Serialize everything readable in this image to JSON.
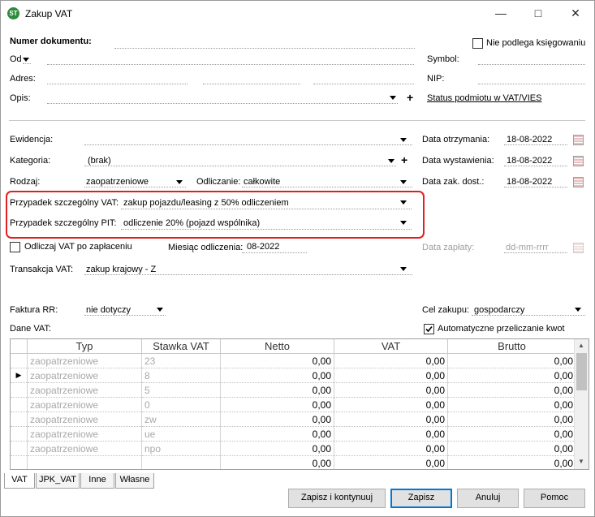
{
  "window": {
    "title": "Zakup VAT",
    "app_icon": "ST"
  },
  "header": {
    "document_number_label": "Numer dokumentu:",
    "not_booked_label": "Nie podlega księgowaniu",
    "from_label": "Od",
    "symbol_label": "Symbol:",
    "address_label": "Adres:",
    "nip_label": "NIP:",
    "description_label": "Opis:",
    "plus": "+",
    "vat_status_link": "Status podmiotu w VAT/VIES"
  },
  "details": {
    "ewidencja_label": "Ewidencja:",
    "kategoria_label": "Kategoria:",
    "kategoria_value": "(brak)",
    "rodzaj_label": "Rodzaj:",
    "rodzaj_value": "zaopatrzeniowe",
    "odliczanie_label": "Odliczanie:",
    "odliczanie_value": "całkowite",
    "special_vat_label": "Przypadek szczególny VAT:",
    "special_vat_value": "zakup pojazdu/leasing z 50% odliczeniem",
    "special_pit_label": "Przypadek szczególny PIT:",
    "special_pit_value": "odliczenie 20% (pojazd wspólnika)",
    "vat_on_payment_label": "Odliczaj VAT po zapłaceniu",
    "deduction_month_label": "Miesiąc odliczenia:",
    "deduction_month_value": "08-2022",
    "transaction_label": "Transakcja VAT:",
    "transaction_value": "zakup krajowy - Z",
    "rr_label": "Faktura RR:",
    "rr_value": "nie dotyczy",
    "purpose_label": "Cel zakupu:",
    "purpose_value": "gospodarczy",
    "vat_data_label": "Dane VAT:",
    "auto_recalc_label": "Automatyczne przeliczanie kwot"
  },
  "dates": {
    "received_label": "Data otrzymania:",
    "received_value": "18-08-2022",
    "issued_label": "Data wystawienia:",
    "issued_value": "18-08-2022",
    "purchase_label": "Data zak. dost.:",
    "purchase_value": "18-08-2022",
    "payment_label": "Data zapłaty:",
    "payment_value": "dd-mm-rrrr"
  },
  "vat_table": {
    "columns": [
      "Typ",
      "Stawka VAT",
      "Netto",
      "VAT",
      "Brutto"
    ],
    "rows": [
      {
        "typ": "zaopatrzeniowe",
        "stawka": "23",
        "netto": "0,00",
        "vat": "0,00",
        "brutto": "0,00"
      },
      {
        "typ": "zaopatrzeniowe",
        "stawka": "8",
        "netto": "0,00",
        "vat": "0,00",
        "brutto": "0,00"
      },
      {
        "typ": "zaopatrzeniowe",
        "stawka": "5",
        "netto": "0,00",
        "vat": "0,00",
        "brutto": "0,00"
      },
      {
        "typ": "zaopatrzeniowe",
        "stawka": "0",
        "netto": "0,00",
        "vat": "0,00",
        "brutto": "0,00"
      },
      {
        "typ": "zaopatrzeniowe",
        "stawka": "zw",
        "netto": "0,00",
        "vat": "0,00",
        "brutto": "0,00"
      },
      {
        "typ": "zaopatrzeniowe",
        "stawka": "ue",
        "netto": "0,00",
        "vat": "0,00",
        "brutto": "0,00"
      },
      {
        "typ": "zaopatrzeniowe",
        "stawka": "npo",
        "netto": "0,00",
        "vat": "0,00",
        "brutto": "0,00"
      },
      {
        "typ": "",
        "stawka": "",
        "netto": "0,00",
        "vat": "0,00",
        "brutto": "0,00"
      }
    ]
  },
  "tabs": [
    "VAT",
    "JPK_VAT",
    "Inne",
    "Własne"
  ],
  "buttons": {
    "save_continue": "Zapisz i kontynuuj",
    "save": "Zapisz",
    "cancel": "Anuluj",
    "help": "Pomoc"
  }
}
